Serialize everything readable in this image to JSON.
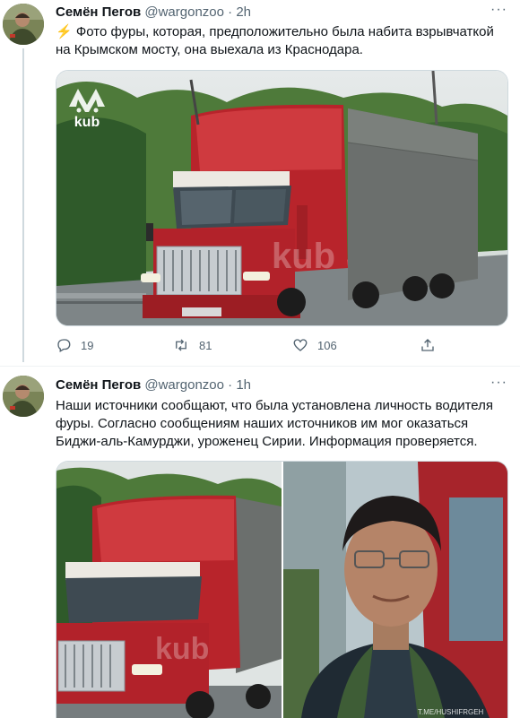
{
  "tweets": [
    {
      "author": "Семён Пегов",
      "handle": "@wargonzoo",
      "separator": "·",
      "time": "2h",
      "emoji": "⚡",
      "text": "Фото фуры, которая, предположительно была набита взрывчаткой на Крымском мосту, она выехала из Краснодара.",
      "media_watermark": "kub",
      "replies": "19",
      "retweets": "81",
      "likes": "106"
    },
    {
      "author": "Семён Пегов",
      "handle": "@wargonzoo",
      "separator": "·",
      "time": "1h",
      "text": "Наши источники сообщают, что была установлена личность водителя фуры. Согласно сообщениям наших источников им мог оказаться Биджи-аль-Камурджи, уроженец Сирии. Информация проверяется.",
      "media_watermark": "kub",
      "photo_caption": "T.ME/HUSHIFRGEH"
    }
  ],
  "more_icon": "more-horizontal-icon",
  "colors": {
    "text": "#0f1419",
    "secondary": "#536471",
    "border": "#cfd9de",
    "bolt": "#f4b400"
  }
}
